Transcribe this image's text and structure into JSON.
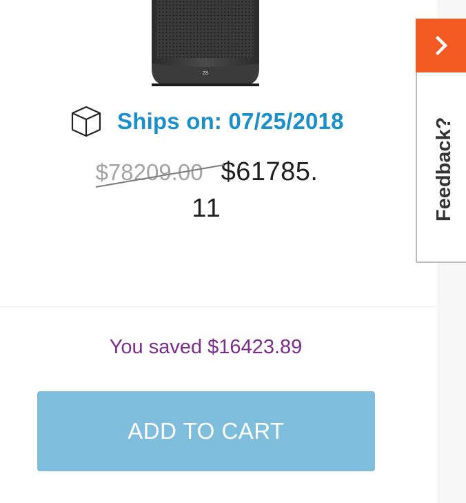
{
  "product": {
    "image_name": "Z8 workstation tower",
    "image_badge": "Z8"
  },
  "shipping": {
    "icon": "box-icon",
    "text": "Ships on: 07/25/2018"
  },
  "pricing": {
    "original_price": "$78209.00",
    "sale_price_line1": "$61785.",
    "sale_price_line2": "11",
    "saved_text": "You saved $16423.89"
  },
  "cart": {
    "button_label": "ADD TO CART"
  },
  "feedback": {
    "icon": "chevron-right-icon",
    "label": "Feedback?"
  },
  "colors": {
    "ships_blue": "#1a8fca",
    "saved_purple": "#7b2d8c",
    "button_blue": "#7fbddd",
    "feedback_orange": "#f25a21"
  }
}
